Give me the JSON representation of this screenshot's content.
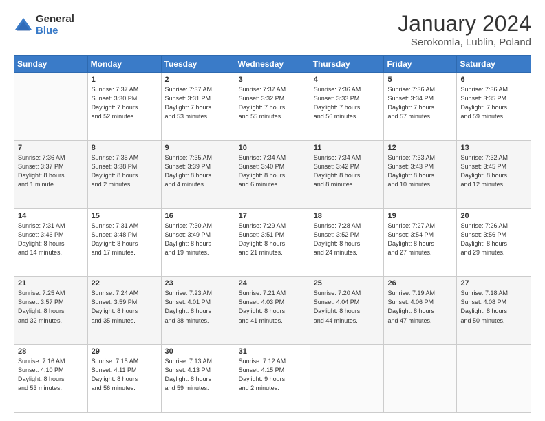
{
  "logo": {
    "general": "General",
    "blue": "Blue"
  },
  "header": {
    "month": "January 2024",
    "location": "Serokomla, Lublin, Poland"
  },
  "columns": [
    "Sunday",
    "Monday",
    "Tuesday",
    "Wednesday",
    "Thursday",
    "Friday",
    "Saturday"
  ],
  "weeks": [
    [
      {
        "day": "",
        "info": ""
      },
      {
        "day": "1",
        "info": "Sunrise: 7:37 AM\nSunset: 3:30 PM\nDaylight: 7 hours\nand 52 minutes."
      },
      {
        "day": "2",
        "info": "Sunrise: 7:37 AM\nSunset: 3:31 PM\nDaylight: 7 hours\nand 53 minutes."
      },
      {
        "day": "3",
        "info": "Sunrise: 7:37 AM\nSunset: 3:32 PM\nDaylight: 7 hours\nand 55 minutes."
      },
      {
        "day": "4",
        "info": "Sunrise: 7:36 AM\nSunset: 3:33 PM\nDaylight: 7 hours\nand 56 minutes."
      },
      {
        "day": "5",
        "info": "Sunrise: 7:36 AM\nSunset: 3:34 PM\nDaylight: 7 hours\nand 57 minutes."
      },
      {
        "day": "6",
        "info": "Sunrise: 7:36 AM\nSunset: 3:35 PM\nDaylight: 7 hours\nand 59 minutes."
      }
    ],
    [
      {
        "day": "7",
        "info": "Sunrise: 7:36 AM\nSunset: 3:37 PM\nDaylight: 8 hours\nand 1 minute."
      },
      {
        "day": "8",
        "info": "Sunrise: 7:35 AM\nSunset: 3:38 PM\nDaylight: 8 hours\nand 2 minutes."
      },
      {
        "day": "9",
        "info": "Sunrise: 7:35 AM\nSunset: 3:39 PM\nDaylight: 8 hours\nand 4 minutes."
      },
      {
        "day": "10",
        "info": "Sunrise: 7:34 AM\nSunset: 3:40 PM\nDaylight: 8 hours\nand 6 minutes."
      },
      {
        "day": "11",
        "info": "Sunrise: 7:34 AM\nSunset: 3:42 PM\nDaylight: 8 hours\nand 8 minutes."
      },
      {
        "day": "12",
        "info": "Sunrise: 7:33 AM\nSunset: 3:43 PM\nDaylight: 8 hours\nand 10 minutes."
      },
      {
        "day": "13",
        "info": "Sunrise: 7:32 AM\nSunset: 3:45 PM\nDaylight: 8 hours\nand 12 minutes."
      }
    ],
    [
      {
        "day": "14",
        "info": "Sunrise: 7:31 AM\nSunset: 3:46 PM\nDaylight: 8 hours\nand 14 minutes."
      },
      {
        "day": "15",
        "info": "Sunrise: 7:31 AM\nSunset: 3:48 PM\nDaylight: 8 hours\nand 17 minutes."
      },
      {
        "day": "16",
        "info": "Sunrise: 7:30 AM\nSunset: 3:49 PM\nDaylight: 8 hours\nand 19 minutes."
      },
      {
        "day": "17",
        "info": "Sunrise: 7:29 AM\nSunset: 3:51 PM\nDaylight: 8 hours\nand 21 minutes."
      },
      {
        "day": "18",
        "info": "Sunrise: 7:28 AM\nSunset: 3:52 PM\nDaylight: 8 hours\nand 24 minutes."
      },
      {
        "day": "19",
        "info": "Sunrise: 7:27 AM\nSunset: 3:54 PM\nDaylight: 8 hours\nand 27 minutes."
      },
      {
        "day": "20",
        "info": "Sunrise: 7:26 AM\nSunset: 3:56 PM\nDaylight: 8 hours\nand 29 minutes."
      }
    ],
    [
      {
        "day": "21",
        "info": "Sunrise: 7:25 AM\nSunset: 3:57 PM\nDaylight: 8 hours\nand 32 minutes."
      },
      {
        "day": "22",
        "info": "Sunrise: 7:24 AM\nSunset: 3:59 PM\nDaylight: 8 hours\nand 35 minutes."
      },
      {
        "day": "23",
        "info": "Sunrise: 7:23 AM\nSunset: 4:01 PM\nDaylight: 8 hours\nand 38 minutes."
      },
      {
        "day": "24",
        "info": "Sunrise: 7:21 AM\nSunset: 4:03 PM\nDaylight: 8 hours\nand 41 minutes."
      },
      {
        "day": "25",
        "info": "Sunrise: 7:20 AM\nSunset: 4:04 PM\nDaylight: 8 hours\nand 44 minutes."
      },
      {
        "day": "26",
        "info": "Sunrise: 7:19 AM\nSunset: 4:06 PM\nDaylight: 8 hours\nand 47 minutes."
      },
      {
        "day": "27",
        "info": "Sunrise: 7:18 AM\nSunset: 4:08 PM\nDaylight: 8 hours\nand 50 minutes."
      }
    ],
    [
      {
        "day": "28",
        "info": "Sunrise: 7:16 AM\nSunset: 4:10 PM\nDaylight: 8 hours\nand 53 minutes."
      },
      {
        "day": "29",
        "info": "Sunrise: 7:15 AM\nSunset: 4:11 PM\nDaylight: 8 hours\nand 56 minutes."
      },
      {
        "day": "30",
        "info": "Sunrise: 7:13 AM\nSunset: 4:13 PM\nDaylight: 8 hours\nand 59 minutes."
      },
      {
        "day": "31",
        "info": "Sunrise: 7:12 AM\nSunset: 4:15 PM\nDaylight: 9 hours\nand 2 minutes."
      },
      {
        "day": "",
        "info": ""
      },
      {
        "day": "",
        "info": ""
      },
      {
        "day": "",
        "info": ""
      }
    ]
  ]
}
